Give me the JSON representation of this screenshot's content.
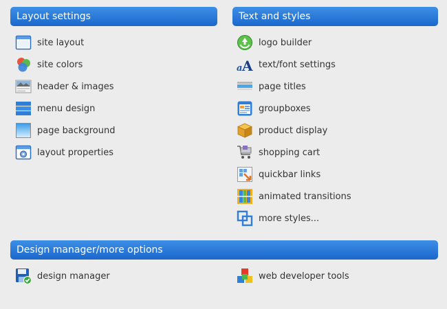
{
  "sections": {
    "layout": {
      "title": "Layout settings",
      "items": [
        {
          "label": "site layout",
          "icon": "window-icon"
        },
        {
          "label": "site colors",
          "icon": "color-circles-icon"
        },
        {
          "label": "header & images",
          "icon": "header-image-icon"
        },
        {
          "label": "menu design",
          "icon": "menu-bars-icon"
        },
        {
          "label": "page background",
          "icon": "background-gradient-icon"
        },
        {
          "label": "layout properties",
          "icon": "window-gear-icon"
        }
      ]
    },
    "text": {
      "title": "Text and styles",
      "items": [
        {
          "label": "logo builder",
          "icon": "recycle-logo-icon"
        },
        {
          "label": "text/font settings",
          "icon": "font-a-icon"
        },
        {
          "label": "page titles",
          "icon": "title-bar-icon"
        },
        {
          "label": "groupboxes",
          "icon": "groupbox-icon"
        },
        {
          "label": "product display",
          "icon": "package-box-icon"
        },
        {
          "label": "shopping cart",
          "icon": "shopping-cart-icon"
        },
        {
          "label": "quickbar links",
          "icon": "quickbar-arrow-icon"
        },
        {
          "label": "animated transitions",
          "icon": "film-strip-icon"
        },
        {
          "label": "more styles...",
          "icon": "overlapping-squares-icon"
        }
      ]
    },
    "design": {
      "title": "Design manager/more options",
      "items": [
        {
          "label": "design manager",
          "icon": "floppy-check-icon"
        },
        {
          "label": "web developer tools",
          "icon": "colored-cubes-icon"
        }
      ]
    }
  }
}
